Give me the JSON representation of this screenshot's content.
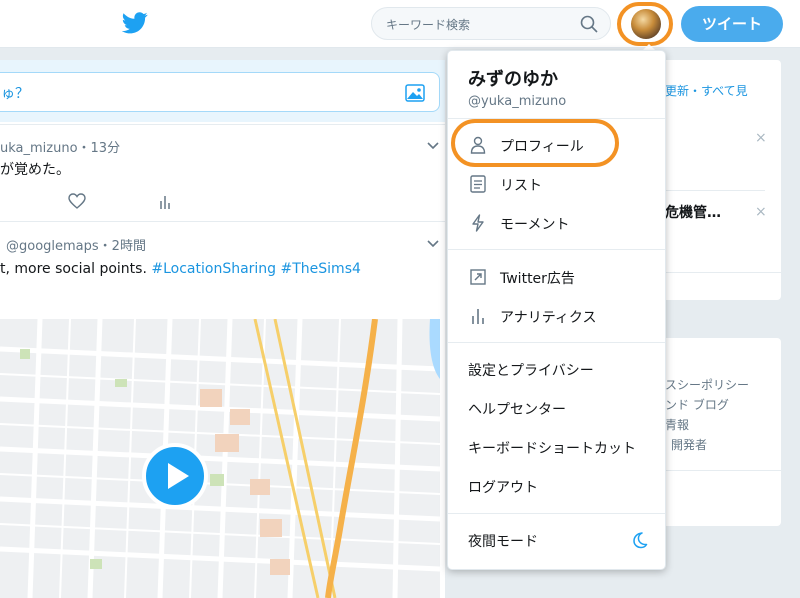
{
  "header": {
    "search_placeholder": "キーワード検索",
    "tweet_button": "ツイート"
  },
  "compose": {
    "prompt": "ゅ？"
  },
  "timeline": {
    "tweet1": {
      "meta": "uka_mizuno・13分",
      "text": "が覚めた。"
    },
    "tweet2": {
      "meta": "@googlemaps・2時間",
      "text_plain": "t, more social points.",
      "hashtag1": "#LocationSharing",
      "hashtag2": "#TheSims4"
    }
  },
  "right_panel": {
    "refresh_link": "更新・すべて見",
    "trend_text": "危機管…",
    "footer_lines": [
      "スシーポリシー",
      "ンド  ブログ",
      "青報",
      "開発者"
    ]
  },
  "dropdown": {
    "name": "みずのゆか",
    "handle": "@yuka_mizuno",
    "items": [
      {
        "label": "プロフィール",
        "icon": "person-icon"
      },
      {
        "label": "リスト",
        "icon": "list-icon"
      },
      {
        "label": "モーメント",
        "icon": "lightning-icon"
      },
      {
        "label": "Twitter広告",
        "icon": "arrow-box-icon"
      },
      {
        "label": "アナリティクス",
        "icon": "bar-chart-icon"
      },
      {
        "label": "設定とプライバシー"
      },
      {
        "label": "ヘルプセンター"
      },
      {
        "label": "キーボードショートカット"
      },
      {
        "label": "ログアウト"
      },
      {
        "label": "夜間モード",
        "icon": "moon-icon"
      }
    ]
  },
  "colors": {
    "accent": "#1da1f2",
    "highlight_ring": "#f39224"
  }
}
